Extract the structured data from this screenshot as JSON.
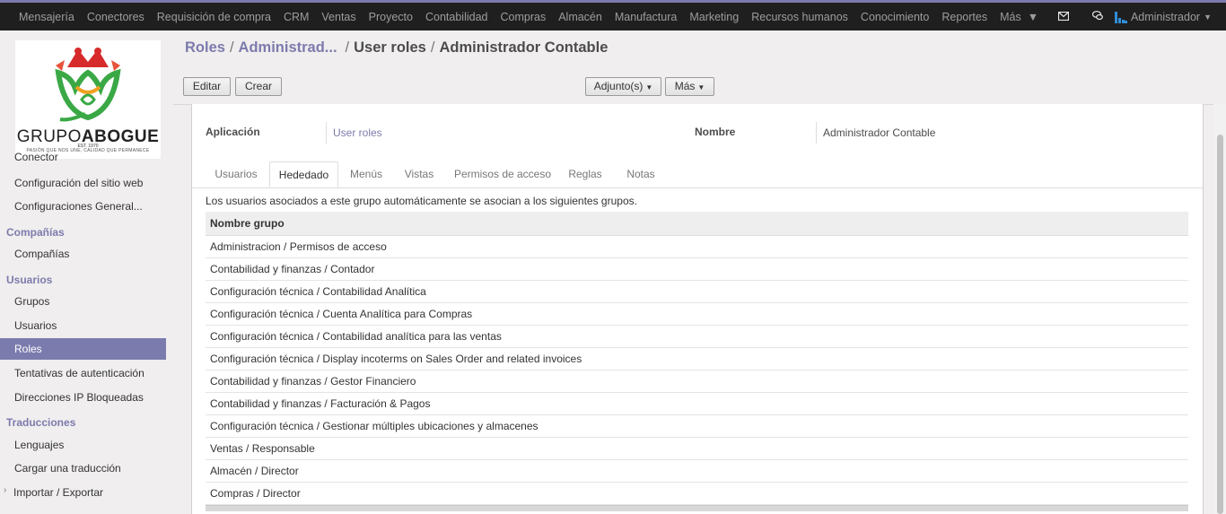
{
  "navbar": {
    "apps": [
      "Mensajería",
      "Conectores",
      "Requisición de compra",
      "CRM",
      "Ventas",
      "Proyecto",
      "Contabilidad",
      "Compras",
      "Almacén",
      "Manufactura",
      "Marketing",
      "Recursos humanos",
      "Conocimiento",
      "Reportes"
    ],
    "more_label": "Más",
    "user_label": "Administrador",
    "icons": [
      "envelope-icon",
      "chat-icon",
      "user-avatar-icon"
    ]
  },
  "logo": {
    "word1": "GRUPO",
    "word2": "ABOGUE",
    "est": "EST. 1970",
    "tagline": "PASIÓN QUE NOS UNE, CALIDAD QUE PERMANECE"
  },
  "sidebar": {
    "items": [
      {
        "type": "item",
        "label": "Conector"
      },
      {
        "type": "item",
        "label": "Configuración del sitio web"
      },
      {
        "type": "item",
        "label": "Configuraciones General..."
      },
      {
        "type": "head",
        "label": "Compañías"
      },
      {
        "type": "item",
        "label": "Compañías"
      },
      {
        "type": "head",
        "label": "Usuarios"
      },
      {
        "type": "item",
        "label": "Grupos"
      },
      {
        "type": "item",
        "label": "Usuarios"
      },
      {
        "type": "item",
        "label": "Roles",
        "active": true
      },
      {
        "type": "item",
        "label": "Tentativas de autenticación"
      },
      {
        "type": "item",
        "label": "Direcciones IP Bloqueadas"
      },
      {
        "type": "head",
        "label": "Traducciones"
      },
      {
        "type": "item",
        "label": "Lenguajes"
      },
      {
        "type": "item",
        "label": "Cargar una traducción"
      },
      {
        "type": "item",
        "label": "Importar / Exportar"
      }
    ]
  },
  "breadcrumb": {
    "crumb1": "Roles",
    "crumb2": "Administrad...",
    "crumb3": "User roles",
    "current": "Administrador Contable",
    "sep": "/"
  },
  "toolbar": {
    "edit_label": "Editar",
    "create_label": "Crear",
    "attachments_label": "Adjunto(s)",
    "more_label": "Más"
  },
  "form": {
    "application_label": "Aplicación",
    "application_value": "User roles",
    "name_label": "Nombre",
    "name_value": "Administrador Contable"
  },
  "tabs": [
    "Usuarios",
    "Hededado",
    "Menús",
    "Vistas",
    "Permisos de acceso",
    "Reglas",
    "Notas"
  ],
  "active_tab": "Hededado",
  "inherited": {
    "help_text": "Los usuarios asociados a este grupo automáticamente se asocian a los siguientes grupos.",
    "column_header": "Nombre grupo",
    "rows": [
      "Administracion / Permisos de acceso",
      "Contabilidad y finanzas / Contador",
      "Configuración técnica / Contabilidad Analítica",
      "Configuración técnica / Cuenta Analítica para Compras",
      "Configuración técnica / Contabilidad analítica para las ventas",
      "Configuración técnica / Display incoterms on Sales Order and related invoices",
      "Contabilidad y finanzas / Gestor Financiero",
      "Contabilidad y finanzas / Facturación & Pagos",
      "Configuración técnica / Gestionar múltiples ubicaciones y almacenes",
      "Ventas / Responsable",
      "Almacén / Director",
      "Compras / Director"
    ]
  },
  "colors": {
    "accent": "#7c7bad",
    "navbar_bg": "#1f1f1f",
    "sidebar_active_bg": "#7c7bad"
  }
}
